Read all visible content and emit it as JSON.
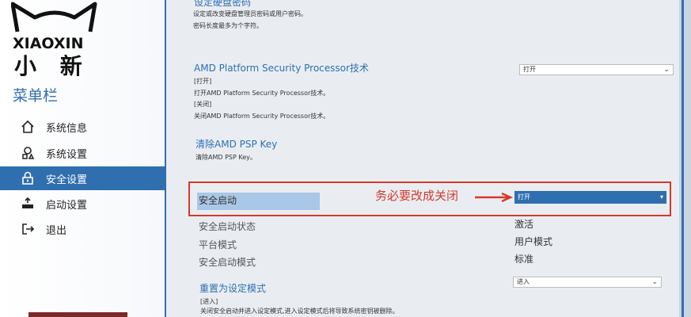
{
  "logo": {
    "brand": "XIAOXIN",
    "brand_cn": "小 新"
  },
  "menu": {
    "title": "菜单栏",
    "items": [
      {
        "label": "系统信息",
        "icon": "home-icon",
        "active": false
      },
      {
        "label": "系统设置",
        "icon": "settings-icon",
        "active": false
      },
      {
        "label": "安全设置",
        "icon": "lock-icon",
        "active": true
      },
      {
        "label": "启动设置",
        "icon": "boot-icon",
        "active": false
      },
      {
        "label": "退出",
        "icon": "exit-icon",
        "active": false
      }
    ]
  },
  "sections": {
    "disk_password": {
      "title_cut": "设定硬盘密码",
      "line1": "设定或改变硬盘管理员密码或用户密码。",
      "line2": "密码长度最多为个字符。"
    },
    "amd_psp": {
      "title": "AMD Platform Security Processor技术",
      "opt_on": "[打开]",
      "desc_on": "打开AMD Platform Security Processor技术。",
      "opt_off": "[关闭]",
      "desc_off": "关闭AMD Platform Security Processor技术。",
      "select_value": "打开"
    },
    "clear_psp": {
      "title": "清除AMD PSP Key",
      "desc": "清除AMD PSP Key。"
    },
    "secure_boot": {
      "label": "安全启动",
      "select_value": "打开",
      "annotation": "务必要改成关闭",
      "status_label": "安全启动状态",
      "status_value": "激活",
      "platform_label": "平台模式",
      "platform_value": "用户模式",
      "mode_label": "安全启动模式",
      "mode_value": "标准"
    },
    "reset_setup": {
      "title": "重置为设定模式",
      "opt": "[进入]",
      "desc": "关闭安全启动并进入设定模式,进入设定模式后将导致系统密钥被删除。",
      "select_value": "进入"
    }
  },
  "colors": {
    "accent": "#2f6fb0",
    "annotation": "#d33a2a"
  }
}
